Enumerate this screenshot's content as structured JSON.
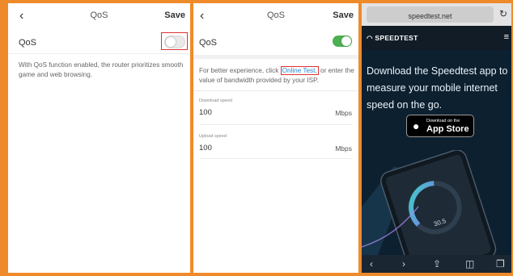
{
  "panel1": {
    "nav": {
      "back_icon": "chevron-left-icon",
      "back_glyph": "‹",
      "title": "QoS",
      "save_label": "Save"
    },
    "qos_label": "QoS",
    "qos_enabled": false,
    "description": "With QoS function enabled, the router prioritizes smooth game and web browsing."
  },
  "panel2": {
    "nav": {
      "back_glyph": "‹",
      "title": "QoS",
      "save_label": "Save"
    },
    "qos_label": "QoS",
    "qos_enabled": true,
    "hint_before": "For better experience, click ",
    "hint_link": "Online Test,",
    "hint_after": " or enter the value of bandwidth provided by your ISP.",
    "download": {
      "label": "Download speed",
      "value": "100",
      "unit": "Mbps"
    },
    "upload": {
      "label": "Upload speed",
      "value": "100",
      "unit": "Mbps"
    }
  },
  "panel3": {
    "url": "speedtest.net",
    "reload_glyph": "↻",
    "logo": "SPEEDTEST",
    "logo_glyph": "◠",
    "menu_glyph": "≡",
    "headline": "Download the Speedtest app to measure your mobile internet speed on the go.",
    "appstore_small": "Download on the",
    "appstore_big": "App Store",
    "toolbar": {
      "back": "‹",
      "forward": "›",
      "share": "⇪",
      "bookmarks": "◫",
      "tabs": "❐"
    }
  },
  "colors": {
    "border": "#ef8a2a",
    "toggle_on": "#4caf50",
    "link": "#2a8ad7",
    "highlight": "#e03030",
    "speedtest_bg": "#0d2030"
  }
}
